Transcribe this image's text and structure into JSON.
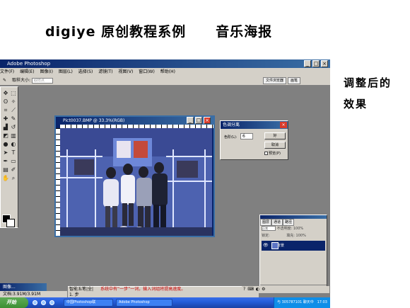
{
  "slide": {
    "title_left": "digiye 原创教程系例",
    "title_right": "音乐海报",
    "side_note_line1": "调整后的",
    "side_note_line2": "效果"
  },
  "photoshop": {
    "window_title": "Adobe Photoshop",
    "menu": [
      "文件(F)",
      "编辑(E)",
      "图像(I)",
      "图层(L)",
      "选择(S)",
      "滤镜(T)",
      "视图(V)",
      "窗口(W)",
      "帮助(H)"
    ],
    "options_label": "取样大小:",
    "options_value": "取样点",
    "dock_tabs": [
      "文件浏览器",
      "画笔"
    ]
  },
  "document": {
    "title": "Pict0037.BMP @ 33.3%(RGB)"
  },
  "posterize_dialog": {
    "title": "色调分离",
    "levels_label": "色阶(L):",
    "levels_value": "6",
    "ok_label": "好",
    "cancel_label": "取消",
    "preview_label": "预览(P)"
  },
  "layers_panel": {
    "tabs": [
      "图层",
      "通道",
      "路径"
    ],
    "blend_mode": "正常",
    "opacity_label": "不透明度: 100%",
    "lock_label": "锁定:",
    "fill_label": "填充: 100%",
    "layer_name": "背景"
  },
  "minimized_window": "图像...",
  "status_bar": {
    "doc_size": "文档:3.91M/3.91M"
  },
  "ime": {
    "mode": "智能五笔|全|",
    "hint": "系统中有“一步”一词，输入词组将提高速度。",
    "line2": "1. 步"
  },
  "taskbar": {
    "start_label": "开始",
    "tasks": [
      "中国Photoshop联",
      "Adobe Photoshop"
    ],
    "tray_text": "与 305787101 聊天中",
    "clock": "17:03"
  }
}
